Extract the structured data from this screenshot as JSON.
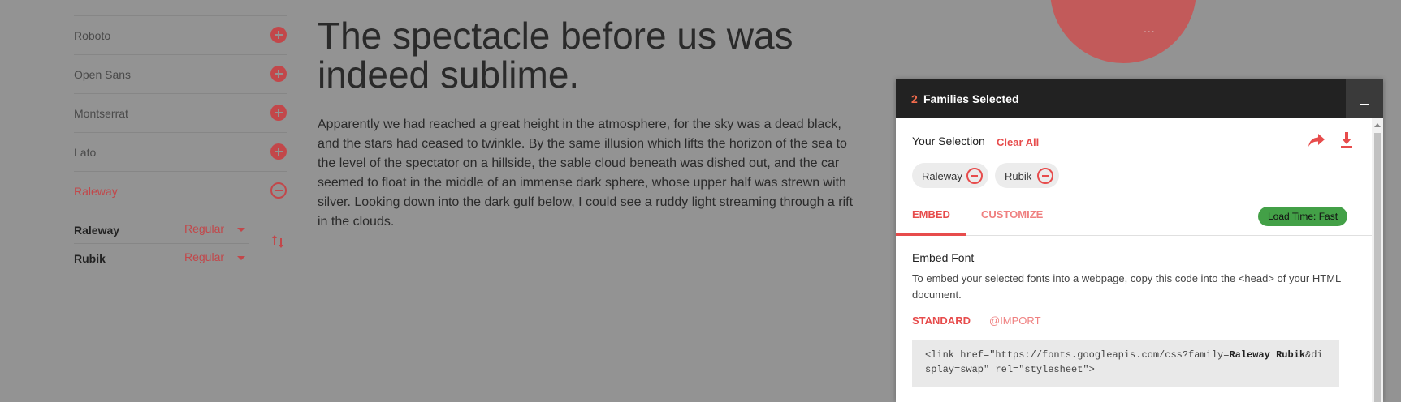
{
  "sidebar": {
    "fonts": [
      {
        "name": "Roboto",
        "action": "add"
      },
      {
        "name": "Open Sans",
        "action": "add"
      },
      {
        "name": "Montserrat",
        "action": "add"
      },
      {
        "name": "Lato",
        "action": "add"
      },
      {
        "name": "Raleway",
        "action": "remove"
      }
    ],
    "selected": [
      {
        "name": "Raleway",
        "style": "Regular"
      },
      {
        "name": "Rubik",
        "style": "Regular"
      }
    ]
  },
  "preview": {
    "headline": "The spectacle before us was indeed sublime.",
    "paragraph": "Apparently we had reached a great height in the atmosphere, for the sky was a dead black, and the stars had ceased to twinkle. By the same illusion which lifts the horizon of the sea to the level of the spectator on a hillside, the sable cloud beneath was dished out, and the car seemed to float in the middle of an immense dark sphere, whose upper half was strewn with silver. Looking down into the dark gulf below, I could see a ruddy light streaming through a rift in the clouds."
  },
  "pie": {
    "partial_label": "...",
    "color": "#c25a5a"
  },
  "drawer": {
    "count": "2",
    "title": "Families Selected",
    "your_selection": "Your Selection",
    "clear_all": "Clear All",
    "chips": [
      "Raleway",
      "Rubik"
    ],
    "tabs": {
      "embed": "EMBED",
      "customize": "CUSTOMIZE"
    },
    "load_time": "Load Time: Fast",
    "embed_heading": "Embed Font",
    "embed_desc": "To embed your selected fonts into a webpage, copy this code into the <head> of your HTML document.",
    "methods": {
      "standard": "STANDARD",
      "import": "@IMPORT"
    },
    "code": {
      "prefix": "<link href=\"https://fonts.googleapis.com/css?family=",
      "family1": "Raleway",
      "sep": "|",
      "family2": "Rubik",
      "suffix": "&display=swap\" rel=\"stylesheet\">"
    }
  },
  "colors": {
    "accent": "#e74c4c",
    "badge_green": "#43a047",
    "header_dark": "#222222"
  }
}
